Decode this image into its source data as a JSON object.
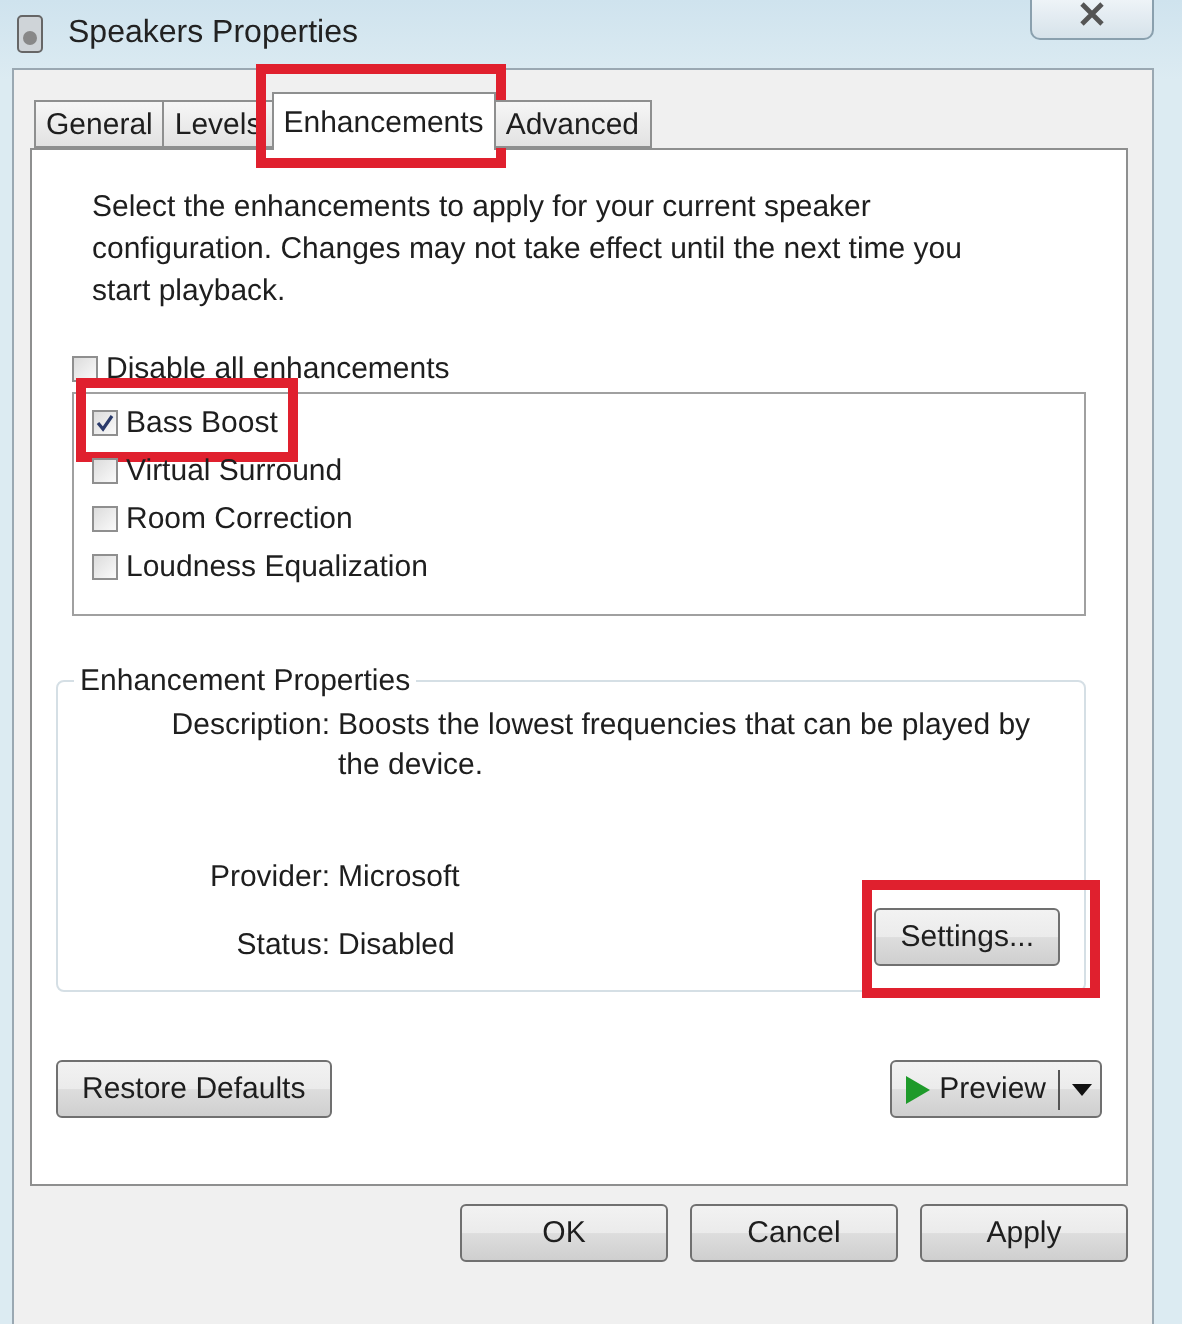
{
  "window": {
    "title": "Speakers Properties"
  },
  "tabs": [
    {
      "label": "General",
      "selected": false,
      "highlighted": false
    },
    {
      "label": "Levels",
      "selected": false,
      "highlighted": false
    },
    {
      "label": "Enhancements",
      "selected": true,
      "highlighted": true
    },
    {
      "label": "Advanced",
      "selected": false,
      "highlighted": false
    }
  ],
  "intro": "Select the enhancements to apply for your current speaker configuration. Changes may not take effect until the next time you start playback.",
  "disable_all": {
    "label": "Disable all enhancements",
    "checked": false
  },
  "enhancements": [
    {
      "label": "Bass Boost",
      "checked": true,
      "highlighted": true
    },
    {
      "label": "Virtual Surround",
      "checked": false,
      "highlighted": false
    },
    {
      "label": "Room Correction",
      "checked": false,
      "highlighted": false
    },
    {
      "label": "Loudness Equalization",
      "checked": false,
      "highlighted": false
    }
  ],
  "properties": {
    "title": "Enhancement Properties",
    "description_label": "Description:",
    "description": "Boosts the lowest frequencies that can be played by the device.",
    "provider_label": "Provider:",
    "provider": "Microsoft",
    "status_label": "Status:",
    "status": "Disabled",
    "settings_button": {
      "label": "Settings...",
      "highlighted": true
    }
  },
  "restore_button": "Restore Defaults",
  "preview_button": "Preview",
  "buttons": [
    "OK",
    "Cancel",
    "Apply"
  ]
}
